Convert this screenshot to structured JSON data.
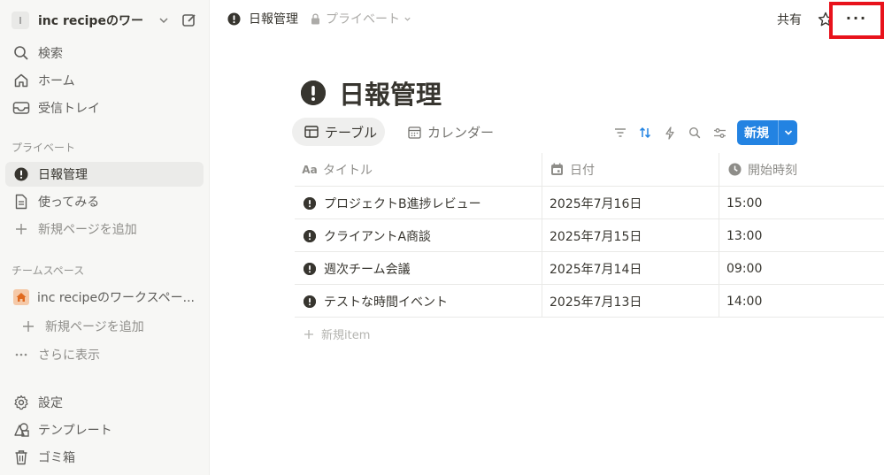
{
  "sidebar": {
    "workspace": {
      "avatar": "I",
      "name": "inc recipeのワー..."
    },
    "top_items": [
      {
        "label": "検索",
        "icon": "search-icon"
      },
      {
        "label": "ホーム",
        "icon": "home-icon"
      },
      {
        "label": "受信トレイ",
        "icon": "inbox-icon"
      }
    ],
    "private_label": "プライベート",
    "private_items": [
      {
        "label": "日報管理",
        "icon": "exclamation-circle-icon",
        "active": true
      },
      {
        "label": "使ってみる",
        "icon": "document-icon"
      },
      {
        "label": "新規ページを追加",
        "icon": "plus-icon"
      }
    ],
    "team_label": "チームスペース",
    "team_items": [
      {
        "label": "inc recipeのワークスペー...",
        "icon": "house-icon"
      },
      {
        "label": "新規ページを追加",
        "icon": "plus-icon"
      },
      {
        "label": "さらに表示",
        "icon": "ellipsis-icon"
      }
    ],
    "bottom_items": [
      {
        "label": "設定",
        "icon": "gear-icon"
      },
      {
        "label": "テンプレート",
        "icon": "shapes-icon"
      },
      {
        "label": "ゴミ箱",
        "icon": "trash-icon"
      }
    ]
  },
  "topbar": {
    "breadcrumb_page": "日報管理",
    "breadcrumb_privacy": "プライベート",
    "share_label": "共有",
    "more_label": "···"
  },
  "page": {
    "title": "日報管理",
    "views": [
      {
        "label": "テーブル",
        "icon": "table-icon"
      },
      {
        "label": "カレンダー",
        "icon": "calendar-icon"
      }
    ],
    "new_button": "新規",
    "table": {
      "columns": [
        {
          "label": "タイトル",
          "icon": "text-icon",
          "icon_text": "Aa"
        },
        {
          "label": "日付",
          "icon": "calendar-icon"
        },
        {
          "label": "開始時刻",
          "icon": "clock-icon"
        }
      ],
      "rows": [
        {
          "title": "プロジェクトB進捗レビュー",
          "date": "2025年7月16日",
          "time": "15:00"
        },
        {
          "title": "クライアントA商談",
          "date": "2025年7月15日",
          "time": "13:00"
        },
        {
          "title": "週次チーム会議",
          "date": "2025年7月14日",
          "time": "09:00"
        },
        {
          "title": "テストな時間イベント",
          "date": "2025年7月13日",
          "time": "14:00"
        }
      ],
      "add_row_label": "新規item"
    }
  },
  "colors": {
    "accent": "#2383e2",
    "highlight": "#e8121b",
    "sidebar_bg": "#f7f7f5",
    "text": "#37352f"
  }
}
